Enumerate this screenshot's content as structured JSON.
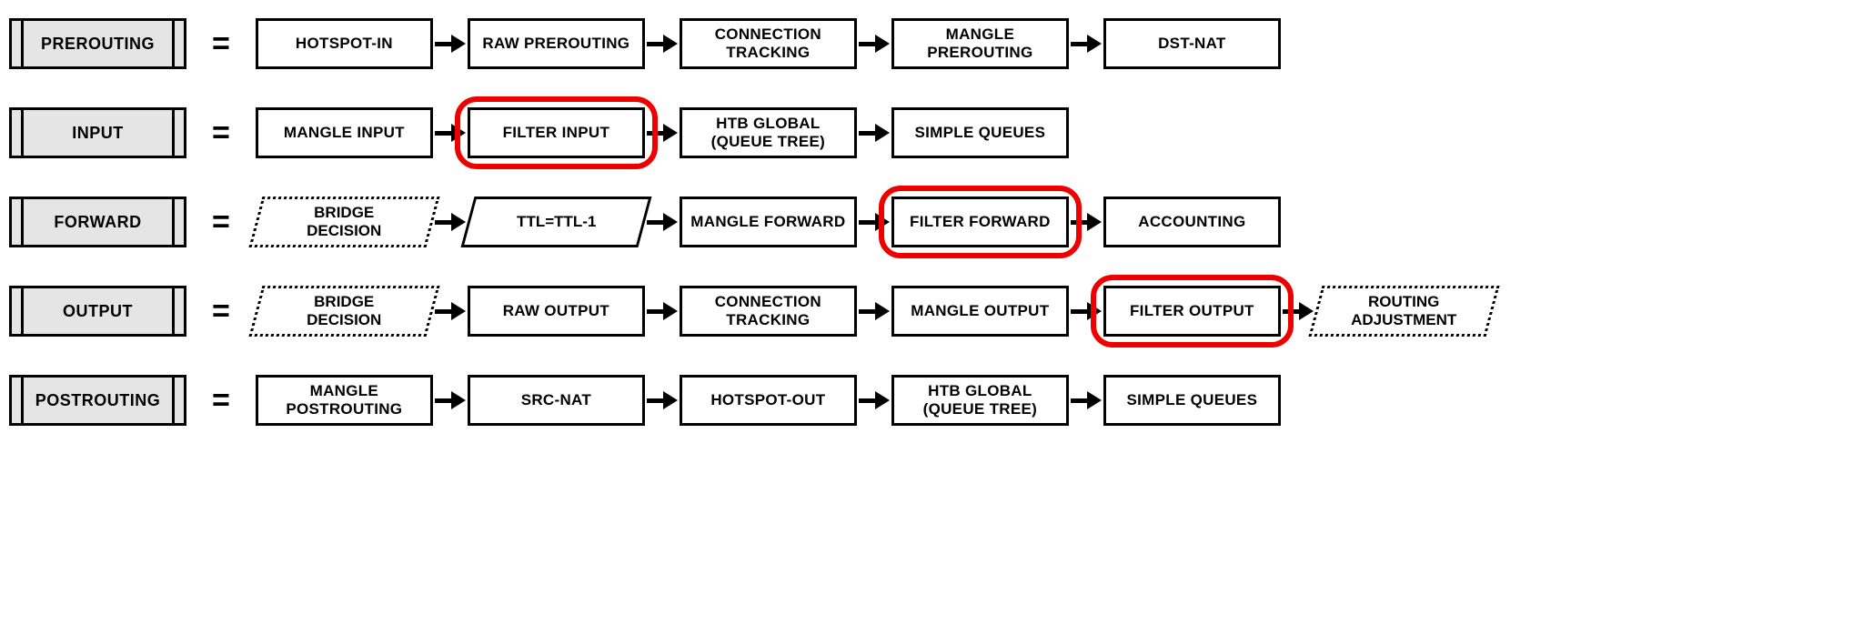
{
  "rows": [
    {
      "chain": "PREROUTING",
      "items": [
        {
          "shape": "box",
          "label": "HOTSPOT-IN"
        },
        {
          "shape": "box",
          "label": "RAW PREROUTING"
        },
        {
          "shape": "box",
          "label": "CONNECTION TRACKING"
        },
        {
          "shape": "box",
          "label": "MANGLE PREROUTING"
        },
        {
          "shape": "box",
          "label": "DST-NAT"
        }
      ]
    },
    {
      "chain": "INPUT",
      "items": [
        {
          "shape": "box",
          "label": "MANGLE INPUT"
        },
        {
          "shape": "box",
          "label": "FILTER INPUT",
          "highlight": true
        },
        {
          "shape": "box",
          "label": "HTB GLOBAL (QUEUE TREE)"
        },
        {
          "shape": "box",
          "label": "SIMPLE QUEUES"
        }
      ]
    },
    {
      "chain": "FORWARD",
      "items": [
        {
          "shape": "para-dotted",
          "label": "BRIDGE DECISION"
        },
        {
          "shape": "para",
          "label": "TTL=TTL-1"
        },
        {
          "shape": "box",
          "label": "MANGLE FORWARD"
        },
        {
          "shape": "box",
          "label": "FILTER FORWARD",
          "highlight": true
        },
        {
          "shape": "box",
          "label": "ACCOUNTING"
        }
      ]
    },
    {
      "chain": "OUTPUT",
      "items": [
        {
          "shape": "para-dotted",
          "label": "BRIDGE DECISION"
        },
        {
          "shape": "box",
          "label": "RAW OUTPUT"
        },
        {
          "shape": "box",
          "label": "CONNECTION TRACKING"
        },
        {
          "shape": "box",
          "label": "MANGLE OUTPUT"
        },
        {
          "shape": "box",
          "label": "FILTER OUTPUT",
          "highlight": true
        },
        {
          "shape": "para-dotted",
          "label": "ROUTING ADJUSTMENT"
        }
      ]
    },
    {
      "chain": "POSTROUTING",
      "items": [
        {
          "shape": "box",
          "label": "MANGLE POSTROUTING"
        },
        {
          "shape": "box",
          "label": "SRC-NAT"
        },
        {
          "shape": "box",
          "label": "HOTSPOT-OUT"
        },
        {
          "shape": "box",
          "label": "HTB GLOBAL (QUEUE TREE)"
        },
        {
          "shape": "box",
          "label": "SIMPLE QUEUES"
        }
      ]
    }
  ],
  "equals_glyph": "="
}
